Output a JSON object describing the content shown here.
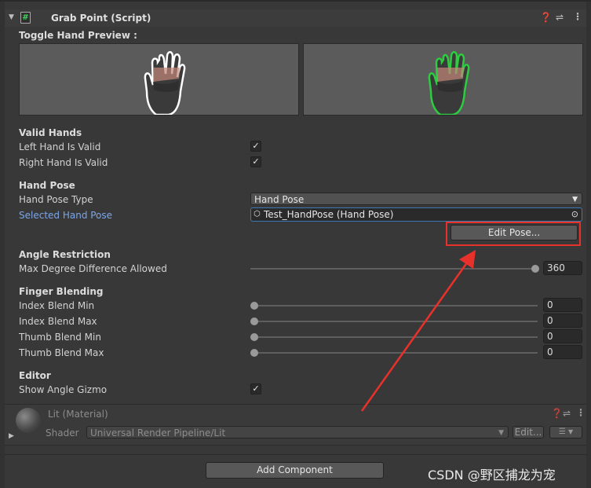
{
  "component": {
    "title": "Grab Point (Script)",
    "toggle_preview_label": "Toggle Hand Preview :"
  },
  "valid_hands": {
    "heading": "Valid Hands",
    "left_label": "Left Hand Is Valid",
    "left_checked": true,
    "right_label": "Right Hand Is Valid",
    "right_checked": true,
    "check_glyph": "✓"
  },
  "hand_pose": {
    "heading": "Hand Pose",
    "type_label": "Hand Pose Type",
    "type_value": "Hand Pose",
    "selected_label": "Selected Hand Pose",
    "selected_value": "Test_HandPose (Hand Pose)",
    "edit_button": "Edit Pose..."
  },
  "angle_restriction": {
    "heading": "Angle Restriction",
    "max_label": "Max Degree Difference Allowed",
    "max_value": "360",
    "slider_fraction": 1.0
  },
  "finger_blending": {
    "heading": "Finger Blending",
    "rows": [
      {
        "label": "Index Blend Min",
        "value": "0"
      },
      {
        "label": "Index Blend Max",
        "value": "0"
      },
      {
        "label": "Thumb Blend Min",
        "value": "0"
      },
      {
        "label": "Thumb Blend Max",
        "value": "0"
      }
    ]
  },
  "editor": {
    "heading": "Editor",
    "gizmo_label": "Show Angle Gizmo",
    "gizmo_checked": true
  },
  "material": {
    "title": "Lit (Material)",
    "shader_label": "Shader",
    "shader_value": "Universal Render Pipeline/Lit",
    "edit_button": "Edit..."
  },
  "add_component_button": "Add Component",
  "watermark": "CSDN @野区捕龙为宠",
  "colors": {
    "accent_blue": "#3b78b6",
    "highlight_red": "#e8312b",
    "preview_green": "#2ecc40"
  }
}
